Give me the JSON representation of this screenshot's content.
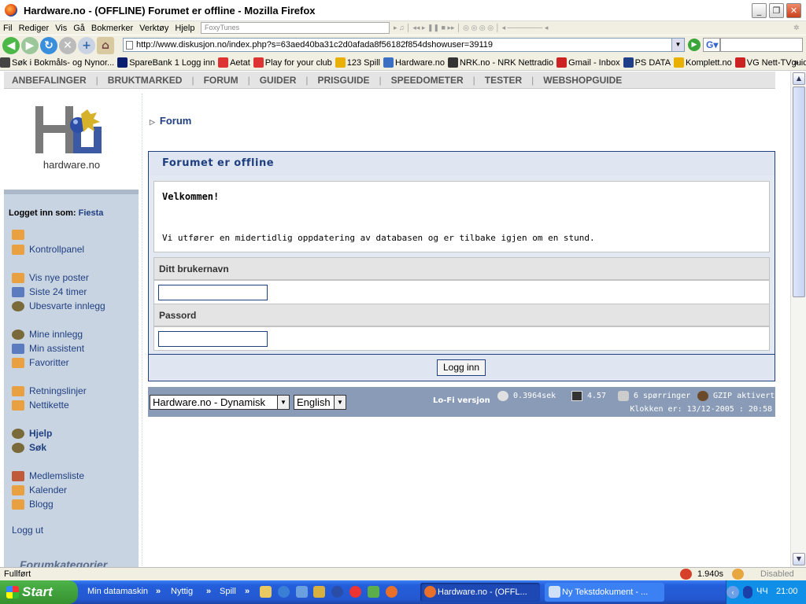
{
  "window": {
    "title": "Hardware.no - (OFFLINE) Forumet er offline - Mozilla Firefox"
  },
  "menu": {
    "items": [
      "Fil",
      "Rediger",
      "Vis",
      "Gå",
      "Bokmerker",
      "Verktøy",
      "Hjelp"
    ],
    "foxytunes": "FoxyTunes"
  },
  "navbar": {
    "url": "http://www.diskusjon.no/index.php?s=63aed40ba31c2d0afada8f56182f854dshowuser=39119"
  },
  "bookmarks": [
    {
      "label": "Søk i Bokmåls- og Nynor...",
      "color": "#444"
    },
    {
      "label": "SpareBank 1 Logg inn",
      "color": "#0b1f6f"
    },
    {
      "label": "Aetat",
      "color": "#d33"
    },
    {
      "label": "Play for your club",
      "color": "#d33"
    },
    {
      "label": "123 Spill",
      "color": "#e9b000"
    },
    {
      "label": "Hardware.no",
      "color": "#3a6fc4"
    },
    {
      "label": "NRK.no - NRK Nettradio",
      "color": "#333"
    },
    {
      "label": "Gmail - Inbox",
      "color": "#c22"
    },
    {
      "label": "PS DATA",
      "color": "#213e88"
    },
    {
      "label": "Komplett.no",
      "color": "#e9b000"
    },
    {
      "label": "VG Nett-TVguiden",
      "color": "#c22"
    }
  ],
  "topnav": [
    "ANBEFALINGER",
    "BRUKTMARKED",
    "FORUM",
    "GUIDER",
    "PRISGUIDE",
    "SPEEDOMETER",
    "TESTER",
    "WEBSHOPGUIDE"
  ],
  "logo": {
    "text": "hardware.no"
  },
  "sidebar": {
    "logged_in_label": "Logget inn som:",
    "username": "Fiesta",
    "items": [
      {
        "label": "",
        "icon": "star-doc-icon"
      },
      {
        "label": "Kontrollpanel",
        "icon": "star-doc-icon"
      },
      {
        "label": "Vis nye poster",
        "icon": "envelope-icon"
      },
      {
        "label": "Siste 24 timer",
        "icon": "calendar-icon"
      },
      {
        "label": "Ubesvarte innlegg",
        "icon": "magnifier-icon"
      },
      {
        "label": "Mine innlegg",
        "icon": "magnifier-icon"
      },
      {
        "label": "Min assistent",
        "icon": "calendar-icon"
      },
      {
        "label": "Favoritter",
        "icon": "star-doc-icon"
      },
      {
        "label": "Retningslinjer",
        "icon": "star-doc-icon"
      },
      {
        "label": "Nettikette",
        "icon": "star-doc-icon"
      },
      {
        "label": "Hjelp",
        "icon": "magnifier-icon"
      },
      {
        "label": "Søk",
        "icon": "magnifier-icon"
      },
      {
        "label": "Medlemsliste",
        "icon": "members-icon"
      },
      {
        "label": "Kalender",
        "icon": "star-doc-icon"
      },
      {
        "label": "Blogg",
        "icon": "envelope-icon"
      }
    ],
    "logout": "Logg ut",
    "forumkat": "Forumkategorier"
  },
  "main": {
    "breadcrumb": "Forum",
    "box_title": "Forumet er offline",
    "welcome_title": "Velkommen!",
    "welcome_text": "Vi utfører en midertidlig oppdatering av databasen og er tilbake igjen om en stund.",
    "username_label": "Ditt brukernavn",
    "password_label": "Passord",
    "login_button": "Logg inn"
  },
  "footer": {
    "style_select": "Hardware.no - Dynamisk",
    "lang_select": "English",
    "lofi": "Lo-Fi versjon",
    "time": "0.3964sek",
    "load": "4.57",
    "queries": "6 spørringer",
    "gzip": "GZIP aktivert",
    "clock": "Klokken er: 13/12-2005 : 20:58"
  },
  "status": {
    "text": "Fullført",
    "timing": "1.940s",
    "disabled": "Disabled"
  },
  "taskbar": {
    "start": "Start",
    "toolbars": [
      "Min datamaskin",
      "Nyttig",
      "Spill"
    ],
    "tasks": [
      "Hardware.no - (OFFL...",
      "Ny Tekstdokument - ..."
    ],
    "lang": "ЧЧ",
    "clock": "21:00"
  }
}
